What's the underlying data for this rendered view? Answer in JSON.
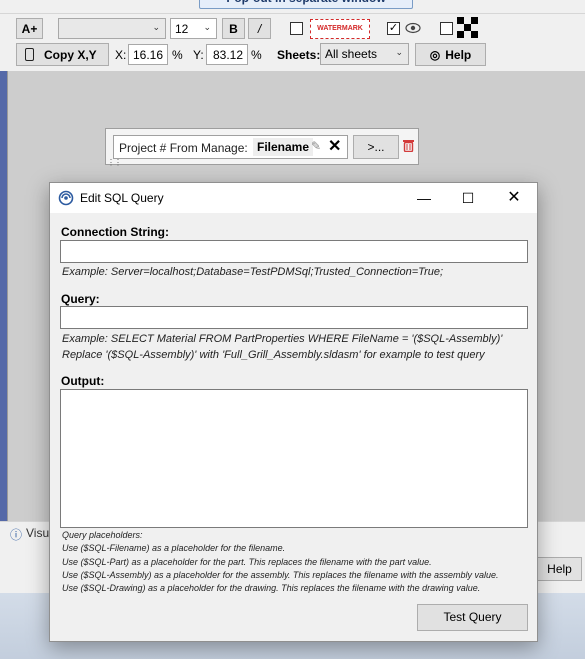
{
  "popout": {
    "label": "Pop-out in separate window"
  },
  "toolbar": {
    "font_grow_label": "A+",
    "font_name_value": "",
    "font_size_value": "12",
    "bold_label": "B",
    "italic_label": "/",
    "watermark_label": "WATERMARK",
    "watermark_checked": false,
    "visible_checked": true,
    "qr_checked": false
  },
  "coords": {
    "copy_label": "Copy X,Y",
    "x_label": "X:",
    "x_value": "16.16",
    "x_unit": "%",
    "y_label": "Y:",
    "y_value": "83.12",
    "y_unit": "%",
    "sheets_label": "Sheets:",
    "sheets_value": "All sheets",
    "help_label": "Help"
  },
  "widget": {
    "prefix": "Project # From Manage:",
    "token": "Filename",
    "more_label": ">..."
  },
  "status": {
    "text": "Visua"
  },
  "bottom": {
    "help_label": "Help"
  },
  "dialog": {
    "title": "Edit SQL Query",
    "connection_label": "Connection String:",
    "connection_value": "",
    "connection_example": "Example: Server=localhost;Database=TestPDMSql;Trusted_Connection=True;",
    "query_label": "Query:",
    "query_value": "",
    "query_example_1": "Example: SELECT Material FROM PartProperties WHERE FileName = '($SQL-Assembly)'",
    "query_example_2": "Replace '($SQL-Assembly)' with 'Full_Grill_Assembly.sldasm' for example to test query",
    "output_label": "Output:",
    "output_value": "",
    "placeholders": [
      "Query placeholders:",
      "Use ($SQL-Filename) as a placeholder for the filename.",
      "Use ($SQL-Part) as a placeholder for the part. This replaces the filename with the part value.",
      "Use ($SQL-Assembly) as a placeholder for the assembly. This replaces the filename with the assembly value.",
      "Use ($SQL-Drawing) as a placeholder for the drawing. This replaces the filename with the drawing value."
    ],
    "test_button": "Test Query"
  },
  "colors": {
    "accent": "#2c5aa0",
    "watermark_red": "#d42a2a",
    "trash_red": "#d33b3b"
  }
}
